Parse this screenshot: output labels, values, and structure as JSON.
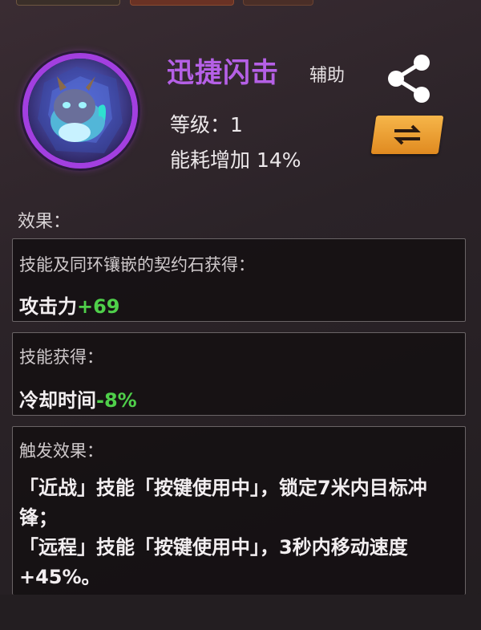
{
  "skill": {
    "name": "迅捷闪击",
    "type": "辅助",
    "level_text": "等级：1",
    "energy_text": "能耗增加 14%"
  },
  "effects": {
    "label": "效果：",
    "panel1": {
      "title": "技能及同环镶嵌的契约石获得：",
      "stat_label": "攻击力",
      "stat_value": "+69"
    },
    "panel2": {
      "title": "技能获得：",
      "stat_label": "冷却时间",
      "stat_value": "-8%"
    },
    "panel3": {
      "title": "触发效果：",
      "line1": "「近战」技能「按键使用中」，锁定7米内目标冲锋；",
      "line2": "「远程」技能「按键使用中」，3秒内移动速度+45%。"
    }
  },
  "icons": {
    "share": "share-icon",
    "swap": "swap-arrows-icon",
    "portrait": "dragon-portrait"
  },
  "colors": {
    "title_purple": "#b560e6",
    "positive_green": "#4fcf4a",
    "swap_orange": "#f0a23a"
  }
}
